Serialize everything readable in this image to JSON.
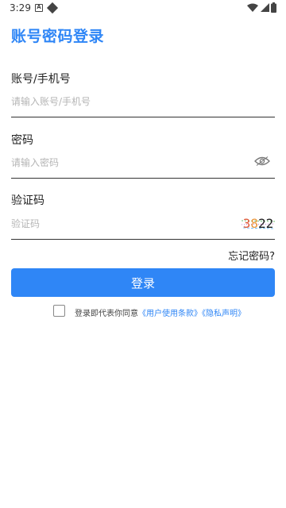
{
  "status_bar": {
    "time": "3:29",
    "notification_letter": "A"
  },
  "page": {
    "title": "账号密码登录"
  },
  "account": {
    "label": "账号/手机号",
    "placeholder": "请输入账号/手机号",
    "value": ""
  },
  "password": {
    "label": "密码",
    "placeholder": "请输入密码",
    "value": ""
  },
  "captcha": {
    "label": "验证码",
    "placeholder": "验证码",
    "value": "",
    "image_text_1": "3",
    "image_text_2": "8",
    "image_text_3": "22"
  },
  "forgot_password": "忘记密码?",
  "login_button": "登录",
  "agreement": {
    "prefix": "登录即代表你同意",
    "user_terms": "《用户使用条款》",
    "privacy": "《隐私声明》",
    "checked": false
  },
  "colors": {
    "accent": "#2f86f6",
    "divider": "#333333",
    "placeholder": "#b5b5b5"
  },
  "icons": {
    "status": [
      "notification-a-icon",
      "diamond-icon",
      "wifi-icon",
      "signal-icon",
      "battery-icon"
    ],
    "password_toggle": "eye-icon"
  }
}
